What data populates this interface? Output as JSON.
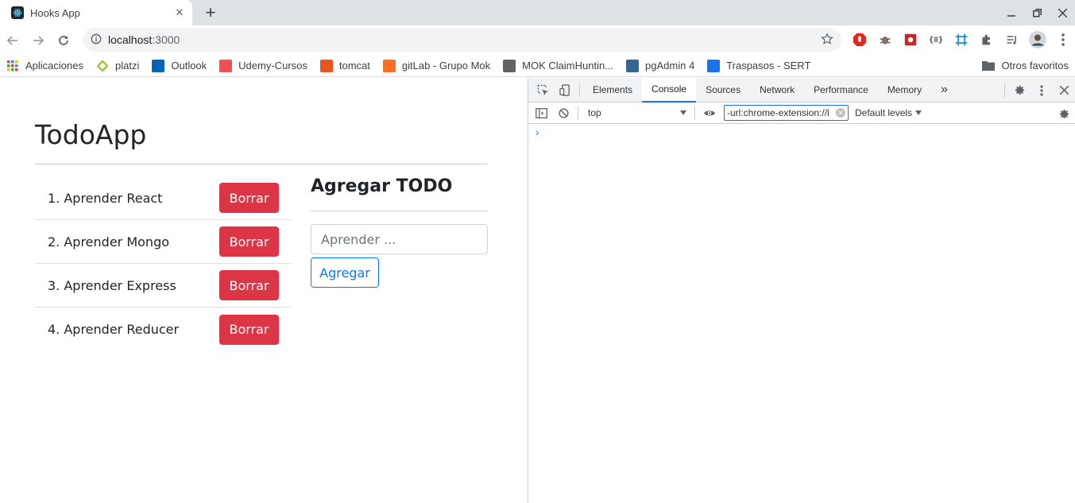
{
  "browser": {
    "tab": {
      "title": "Hooks App",
      "close_glyph": "✕"
    },
    "new_tab_glyph": "+",
    "address": {
      "host": "localhost",
      "port": ":3000"
    },
    "bookmarks": [
      {
        "label": "Aplicaciones",
        "icon": "apps-grid-icon",
        "color": "#ea4335"
      },
      {
        "label": "platzi",
        "icon": "platzi-icon",
        "color": "#98ca3f"
      },
      {
        "label": "Outlook",
        "icon": "outlook-icon",
        "color": "#0364b8"
      },
      {
        "label": "Udemy-Cursos",
        "icon": "udemy-icon",
        "color": "#ec5252"
      },
      {
        "label": "tomcat",
        "icon": "ubuntu-icon",
        "color": "#e95420"
      },
      {
        "label": "gitLab - Grupo Mok",
        "icon": "gitlab-icon",
        "color": "#fc6d26"
      },
      {
        "label": "MOK ClaimHuntin...",
        "icon": "chart-icon",
        "color": "#5f6368"
      },
      {
        "label": "pgAdmin 4",
        "icon": "pgadmin-icon",
        "color": "#336791"
      },
      {
        "label": "Traspasos - SERT",
        "icon": "sert-icon",
        "color": "#1a73e8"
      }
    ],
    "other_bookmarks": "Otros favoritos"
  },
  "app": {
    "title": "TodoApp",
    "todos": [
      {
        "text": "1. Aprender React",
        "button": "Borrar"
      },
      {
        "text": "2. Aprender Mongo",
        "button": "Borrar"
      },
      {
        "text": "3. Aprender Express",
        "button": "Borrar"
      },
      {
        "text": "4. Aprender Reducer",
        "button": "Borrar"
      }
    ],
    "add_section": {
      "title": "Agregar TODO",
      "input_placeholder": "Aprender ...",
      "input_value": "",
      "button": "Agregar"
    }
  },
  "devtools": {
    "tabs": [
      "Elements",
      "Console",
      "Sources",
      "Network",
      "Performance",
      "Memory"
    ],
    "active_tab": "Console",
    "more_tabs_glyph": "»",
    "context": "top",
    "filter_value": "-url:chrome-extension://l",
    "levels": "Default levels",
    "prompt": "›"
  },
  "colors": {
    "danger": "#dc3545",
    "primary": "#007bff",
    "devtools_accent": "#1a73e8"
  }
}
